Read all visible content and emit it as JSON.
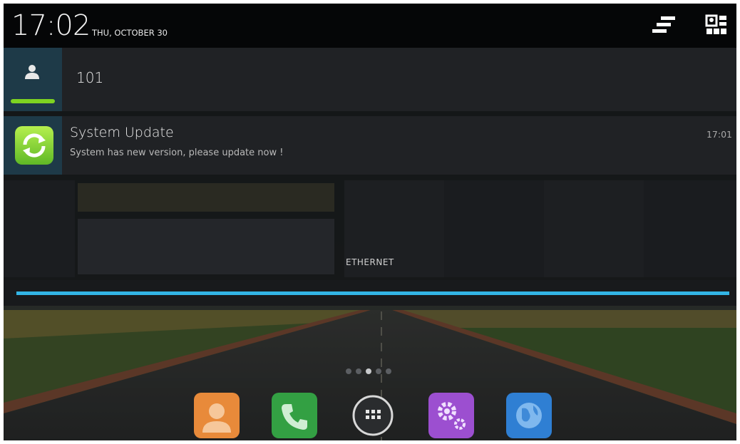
{
  "status_bar": {
    "time": "17:02",
    "date": "THU, OCTOBER 30",
    "icons": [
      "notification-settings-icon",
      "quick-settings-icon"
    ]
  },
  "user": {
    "label": "101",
    "icon": "user-icon"
  },
  "notification": {
    "title": "System Update",
    "text": "System has new version, please update now !",
    "time": "17:01",
    "icon": "system-update-icon"
  },
  "quick_settings": {
    "ethernet_label": "ETHERNET",
    "progress": 1.0
  },
  "home": {
    "page_indicator": {
      "count": 5,
      "active": 2
    },
    "dock": [
      {
        "name": "contacts-icon",
        "color": "#e88a3a"
      },
      {
        "name": "phone-icon",
        "color": "#33a043"
      },
      {
        "name": "app-drawer-icon",
        "color": "#2a2c2e"
      },
      {
        "name": "settings-icon",
        "color": "#9c4fd0"
      },
      {
        "name": "browser-icon",
        "color": "#2f7fd3"
      }
    ]
  },
  "colors": {
    "accent": "#33b5e5",
    "highlight": "#7ed321"
  }
}
